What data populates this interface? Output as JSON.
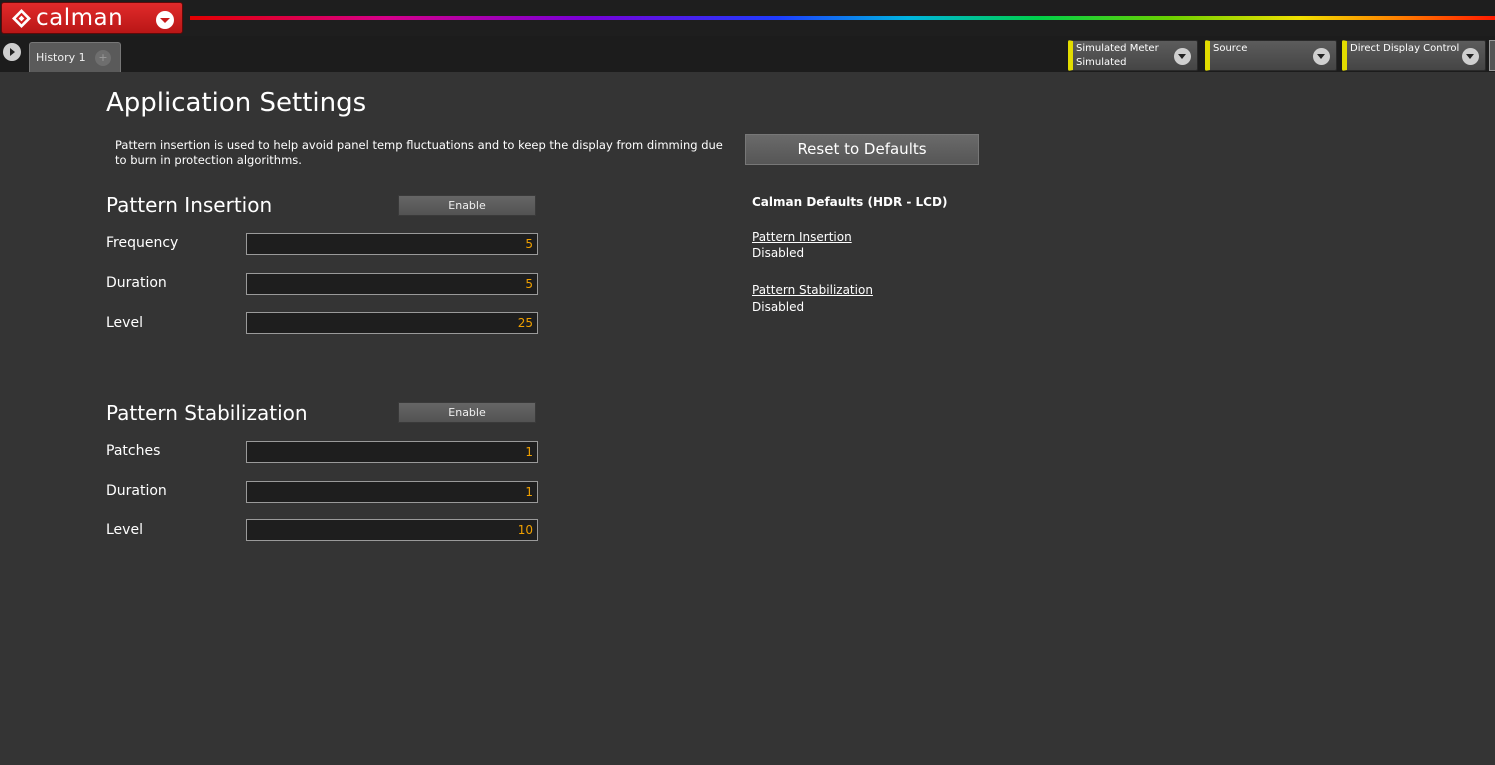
{
  "brand": {
    "name": "calman",
    "accent": "#d42020"
  },
  "tabs": [
    {
      "label": "History 1"
    }
  ],
  "tab_add_glyph": "+",
  "devices": {
    "meter": {
      "line1": "Simulated Meter",
      "line2": "Simulated"
    },
    "source": {
      "line1": "Source",
      "line2": ""
    },
    "ddc": {
      "line1": "Direct Display Control",
      "line2": ""
    }
  },
  "page": {
    "title": "Application Settings",
    "description": "Pattern insertion is used to help avoid panel temp fluctuations and to keep the display from dimming due to burn in protection algorithms.",
    "reset_label": "Reset to Defaults"
  },
  "insertion": {
    "title": "Pattern Insertion",
    "enable_label": "Enable",
    "fields": [
      {
        "label": "Frequency",
        "value": "5"
      },
      {
        "label": "Duration",
        "value": "5"
      },
      {
        "label": "Level",
        "value": "25"
      }
    ]
  },
  "stabilization": {
    "title": "Pattern Stabilization",
    "enable_label": "Enable",
    "fields": [
      {
        "label": "Patches",
        "value": "1"
      },
      {
        "label": "Duration",
        "value": "1"
      },
      {
        "label": "Level",
        "value": "10"
      }
    ]
  },
  "defaults": {
    "title": "Calman Defaults (HDR - LCD)",
    "items": [
      {
        "label": "Pattern Insertion",
        "value": "Disabled"
      },
      {
        "label": "Pattern Stabilization",
        "value": "Disabled"
      }
    ]
  },
  "colors": {
    "value_text": "#f0a000",
    "device_marker": "#e2dc00",
    "background": "#343434"
  }
}
